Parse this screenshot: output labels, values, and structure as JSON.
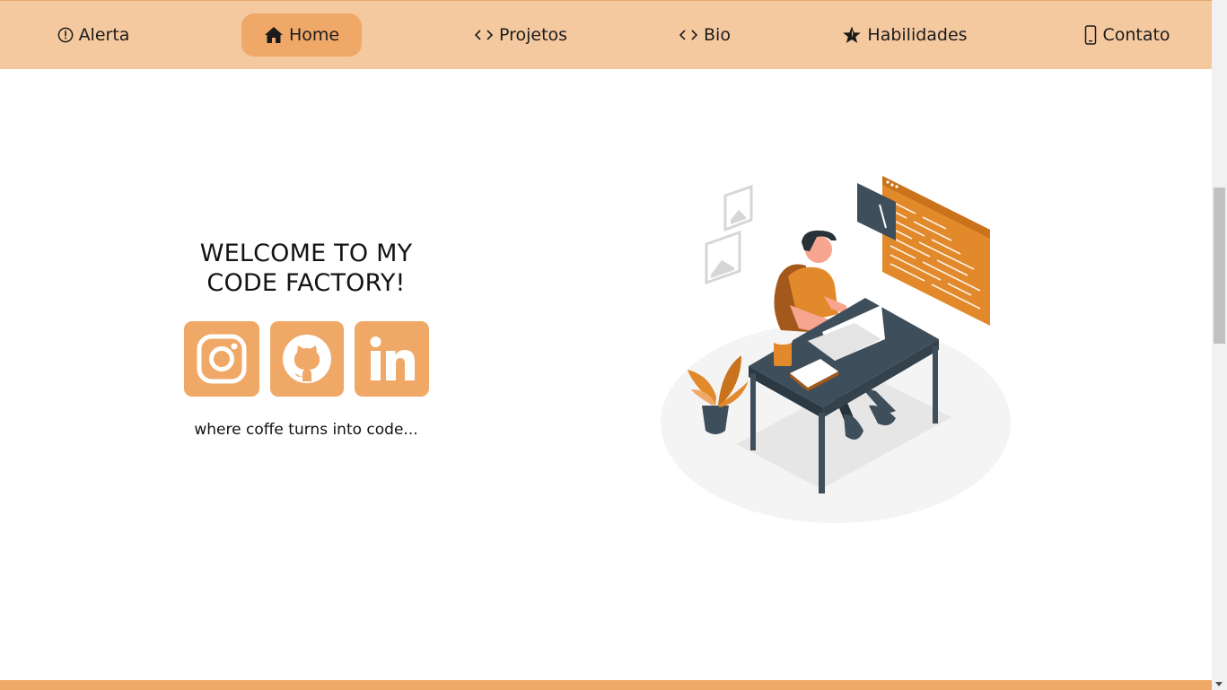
{
  "nav": {
    "items": [
      {
        "label": "Alerta",
        "icon": "alert-circle-icon"
      },
      {
        "label": "Home",
        "icon": "home-icon",
        "active": true
      },
      {
        "label": "Projetos",
        "icon": "code-brackets-icon"
      },
      {
        "label": "Bio",
        "icon": "code-brackets-icon"
      },
      {
        "label": "Habilidades",
        "icon": "star-icon"
      },
      {
        "label": "Contato",
        "icon": "phone-icon"
      }
    ]
  },
  "hero": {
    "title_line1": "WELCOME TO MY",
    "title_line2": "CODE FACTORY!",
    "tagline": "where coffe turns into code...",
    "social": [
      {
        "name": "instagram",
        "icon": "instagram-icon"
      },
      {
        "name": "github",
        "icon": "github-icon"
      },
      {
        "name": "linkedin",
        "icon": "linkedin-icon"
      }
    ]
  },
  "colors": {
    "nav_bg": "#f5c9a0",
    "accent": "#f0a866",
    "illustration_orange": "#e28a2b",
    "illustration_dark": "#3f4e5b"
  }
}
